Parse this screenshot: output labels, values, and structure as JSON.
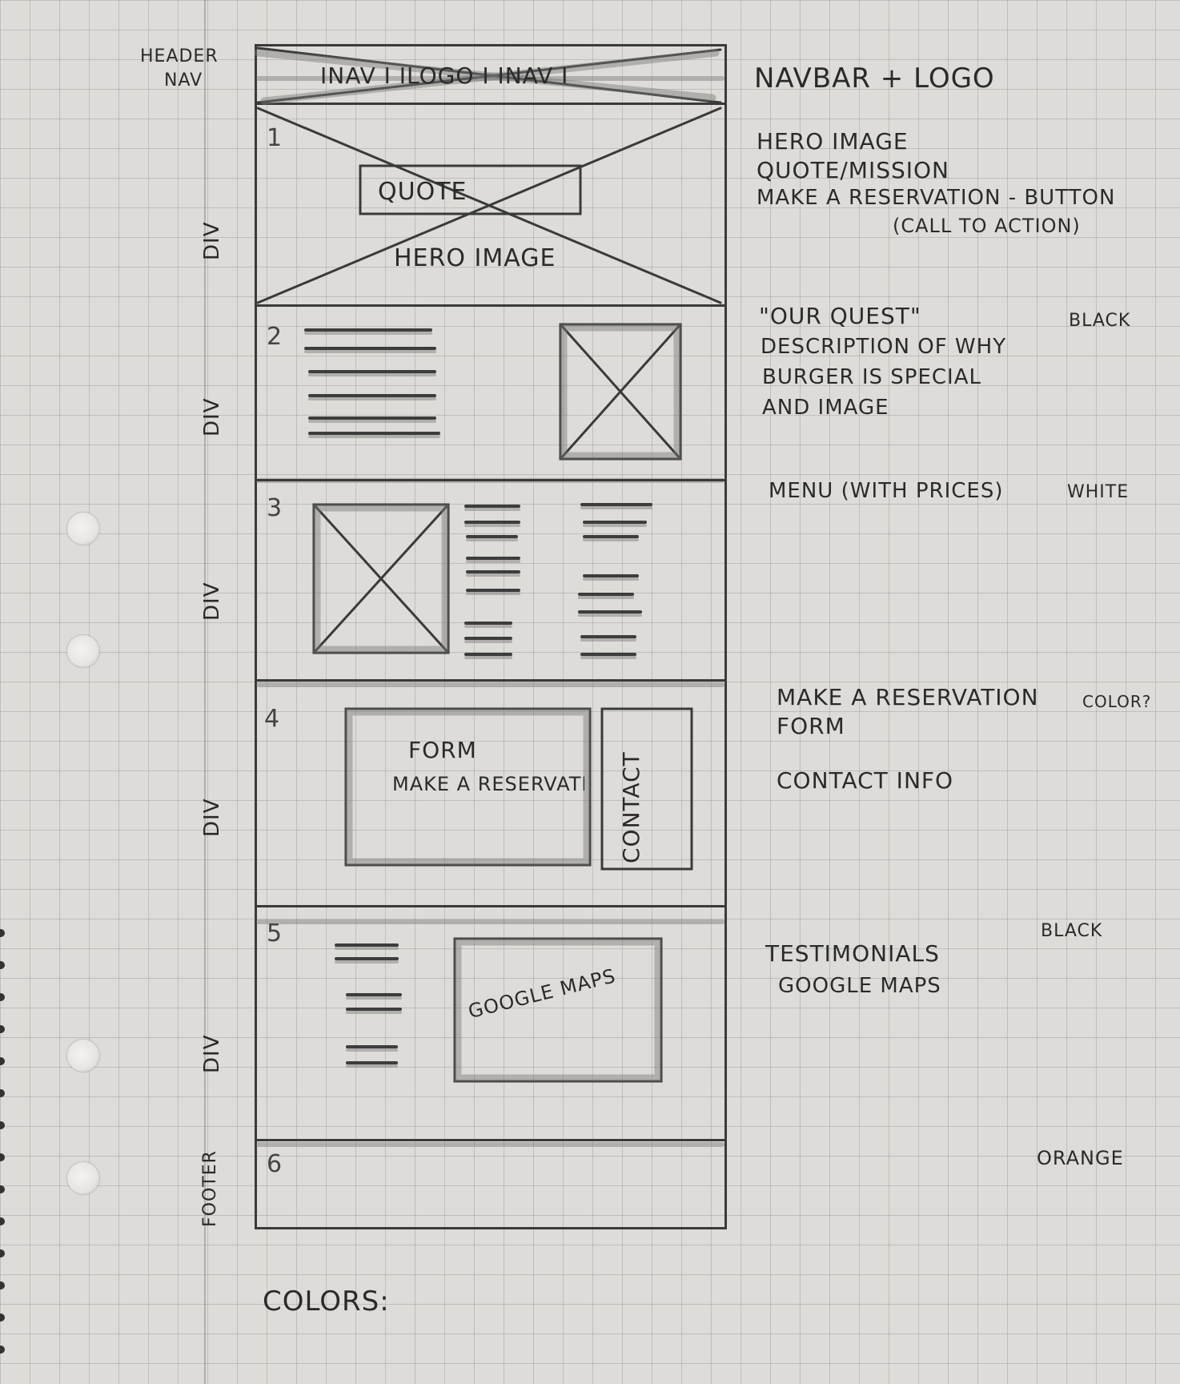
{
  "left_labels": {
    "header": "HEADER",
    "nav": "NAV",
    "divs": [
      "DIV",
      "DIV",
      "DIV",
      "DIV",
      "DIV"
    ],
    "footer": "FOOTER"
  },
  "wireframe": {
    "nav_bar": "INAV I ILOGO I INAV I",
    "sections": [
      {
        "number": "1",
        "labels": [
          "QUOTE",
          "HERO IMAGE"
        ]
      },
      {
        "number": "2",
        "labels": []
      },
      {
        "number": "3",
        "labels": []
      },
      {
        "number": "4",
        "labels": [
          "FORM",
          "MAKE A RESERVATION",
          "CONTACT"
        ]
      },
      {
        "number": "5",
        "labels": [
          "GOOGLE MAPS"
        ]
      },
      {
        "number": "6",
        "labels": []
      }
    ]
  },
  "notes": {
    "nav": "NAVBAR + LOGO",
    "hero": [
      "HERO IMAGE",
      "QUOTE/MISSION",
      "MAKE A RESERVATION - BUTTON",
      "(CALL TO ACTION)"
    ],
    "quest": [
      "\"OUR QUEST\"",
      "DESCRIPTION OF WHY",
      "BURGER IS SPECIAL",
      "AND IMAGE"
    ],
    "quest_color": "BLACK",
    "menu": "MENU (WITH PRICES)",
    "menu_color": "WHITE",
    "reservation": [
      "MAKE A RESERVATION",
      "FORM"
    ],
    "reservation_color": "COLOR?",
    "contact": "CONTACT INFO",
    "testimonials": [
      "TESTIMONIALS",
      "GOOGLE MAPS"
    ],
    "testimonials_color": "BLACK",
    "footer_color": "ORANGE"
  },
  "colors_label": "COLORS:"
}
